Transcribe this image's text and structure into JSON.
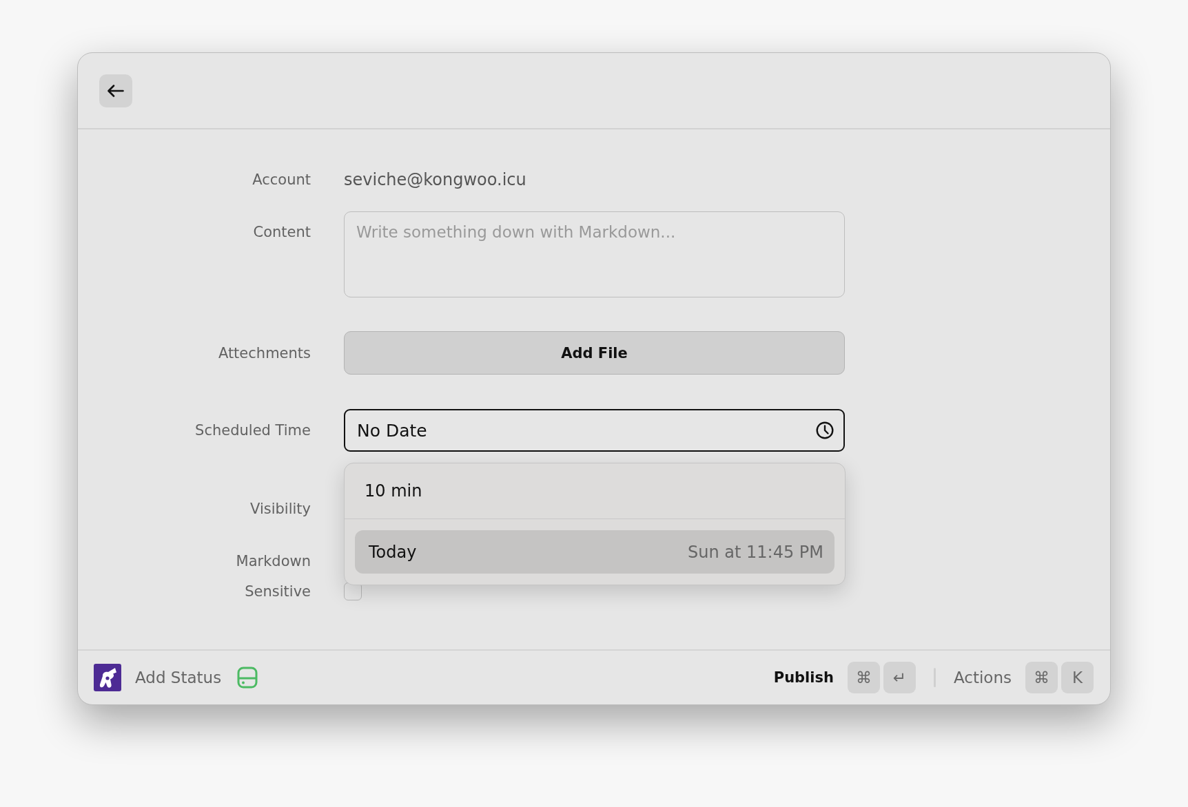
{
  "form": {
    "rows": [
      {
        "kind": "text",
        "label": "Account",
        "value": "seviche@kongwoo.icu"
      },
      {
        "kind": "textarea",
        "label": "Content",
        "placeholder": "Write something down with Markdown..."
      },
      {
        "kind": "button",
        "label": "Attechments",
        "button": "Add File"
      },
      {
        "kind": "date",
        "label": "Scheduled Time",
        "value": "No Date",
        "focused": true,
        "expanded": true,
        "options": [
          {
            "label": "10 min",
            "selected": false
          },
          {
            "label": "Today",
            "detail": "Sun at 11:45 PM",
            "selected": true
          }
        ]
      },
      {
        "kind": "covered",
        "label": "Visibility"
      },
      {
        "kind": "covered",
        "label": "Markdown"
      },
      {
        "kind": "checkbox",
        "label": "Sensitive",
        "checked": false
      }
    ]
  },
  "footer": {
    "title": "Add Status",
    "actions": [
      {
        "label": "Publish",
        "primary": true,
        "keys": [
          "⌘",
          "↵"
        ]
      },
      {
        "label": "Actions",
        "primary": false,
        "keys": [
          "⌘",
          "K"
        ]
      }
    ]
  }
}
